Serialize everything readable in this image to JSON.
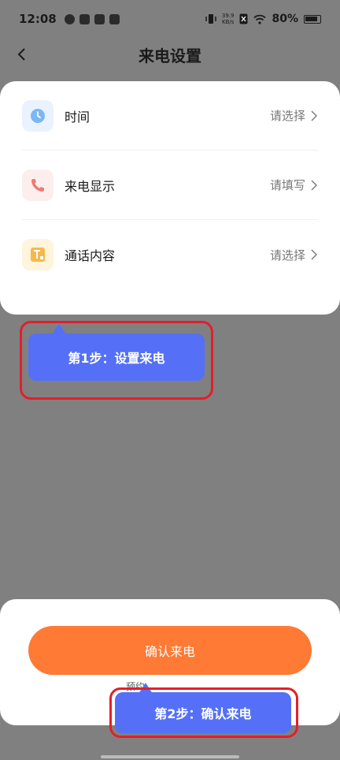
{
  "status_bar": {
    "time": "12:08",
    "net_speed_value": "39.9",
    "net_speed_unit": "KB/s",
    "battery": "80%"
  },
  "nav": {
    "title": "来电设置",
    "back_icon": "chevron-left-icon"
  },
  "settings": {
    "items": [
      {
        "label": "时间",
        "value": "请选择",
        "icon": "clock-icon"
      },
      {
        "label": "来电显示",
        "value": "请填写",
        "icon": "phone-icon"
      },
      {
        "label": "通话内容",
        "value": "请选择",
        "icon": "text-icon"
      }
    ]
  },
  "tips": {
    "step1": "第1步：设置来电",
    "step2": "第2步：确认来电"
  },
  "sheet": {
    "confirm_label": "确认来电",
    "sub_text": "预约..."
  },
  "colors": {
    "accent_orange": "#ff7a35",
    "tip_blue": "#5570f6",
    "highlight_red": "#e41e2b"
  }
}
